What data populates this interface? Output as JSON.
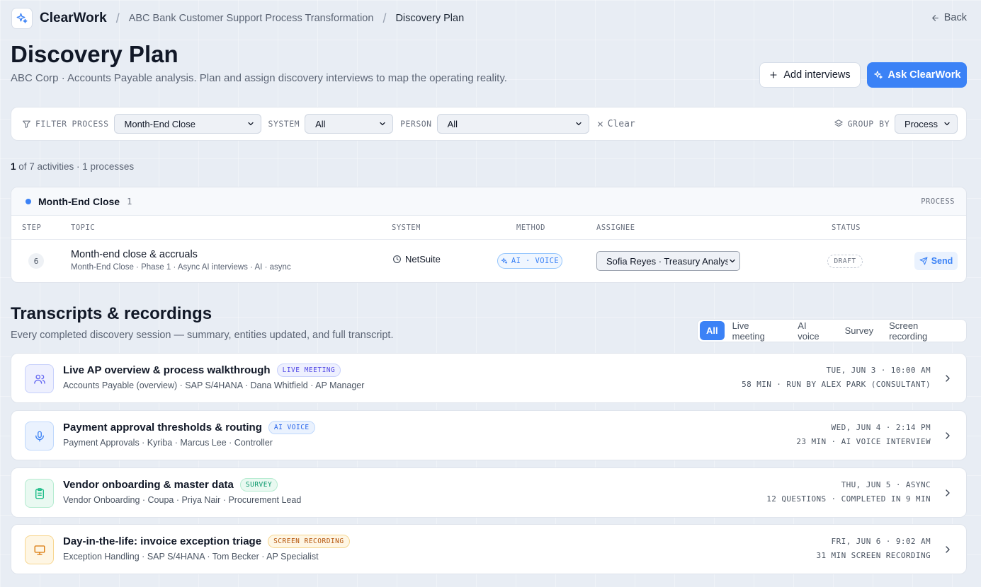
{
  "topbar": {
    "brand": "ClearWork",
    "breadcrumb": [
      "ABC Bank Customer Support Process Transformation",
      "Discovery Plan"
    ],
    "back_label": "Back"
  },
  "header": {
    "title": "Discovery Plan",
    "subtitle": "ABC Corp · Accounts Payable analysis. Plan and assign discovery interviews to map the operating reality.",
    "add_label": "Add interviews",
    "ask_label": "Ask ClearWork"
  },
  "filters": {
    "filter_label": "FILTER",
    "process_label": "PROCESS",
    "process_value": "Month-End Close",
    "system_label": "SYSTEM",
    "system_value": "All",
    "person_label": "PERSON",
    "person_value": "All",
    "clear_label": "Clear",
    "groupby_label": "GROUP BY",
    "groupby_value": "Process"
  },
  "summary": {
    "shown": "1",
    "rest": " of 7 activities · 1 processes"
  },
  "process_group": {
    "name": "Month-End Close",
    "count": "1",
    "tag": "PROCESS",
    "columns": {
      "step": "STEP",
      "topic": "TOPIC",
      "system": "SYSTEM",
      "method": "METHOD",
      "assignee": "ASSIGNEE",
      "status": "STATUS"
    },
    "rows": [
      {
        "step": "6",
        "topic": "Month-end close & accruals",
        "sub": "Month-End Close · Phase 1 · Async AI interviews · AI · async",
        "system": "NetSuite",
        "method": "AI · VOICE",
        "assignee": "Sofia Reyes · Treasury Analyst",
        "status": "DRAFT",
        "action": "Send"
      }
    ]
  },
  "transcripts": {
    "title": "Transcripts & recordings",
    "subtitle": "Every completed discovery session — summary, entities updated, and full transcript.",
    "tabs": [
      "All",
      "Live meeting",
      "AI voice",
      "Survey",
      "Screen recording"
    ],
    "active_tab": "All",
    "items": [
      {
        "icon": "users-icon",
        "title": "Live AP overview & process walkthrough",
        "badge": "LIVE MEETING",
        "sub": "Accounts Payable (overview) · SAP S/4HANA · Dana Whitfield · AP Manager",
        "meta1": "TUE, JUN 3 · 10:00 AM",
        "meta2": "58 MIN · RUN BY ALEX PARK (CONSULTANT)"
      },
      {
        "icon": "microphone-icon",
        "title": "Payment approval thresholds & routing",
        "badge": "AI VOICE",
        "sub": "Payment Approvals · Kyriba · Marcus Lee · Controller",
        "meta1": "WED, JUN 4 · 2:14 PM",
        "meta2": "23 MIN · AI VOICE INTERVIEW"
      },
      {
        "icon": "clipboard-icon",
        "title": "Vendor onboarding & master data",
        "badge": "SURVEY",
        "sub": "Vendor Onboarding · Coupa · Priya Nair · Procurement Lead",
        "meta1": "THU, JUN 5 · ASYNC",
        "meta2": "12 QUESTIONS · COMPLETED IN 9 MIN"
      },
      {
        "icon": "monitor-icon",
        "title": "Day-in-the-life: invoice exception triage",
        "badge": "SCREEN RECORDING",
        "sub": "Exception Handling · SAP S/4HANA · Tom Becker · AP Specialist",
        "meta1": "FRI, JUN 6 · 9:02 AM",
        "meta2": "31 MIN SCREEN RECORDING"
      }
    ]
  },
  "colors": {
    "accent": "#3b82f6",
    "live_meeting": "#6366f1",
    "ai_voice": "#3b82f6",
    "survey": "#10b981",
    "screen_recording": "#d97706"
  }
}
